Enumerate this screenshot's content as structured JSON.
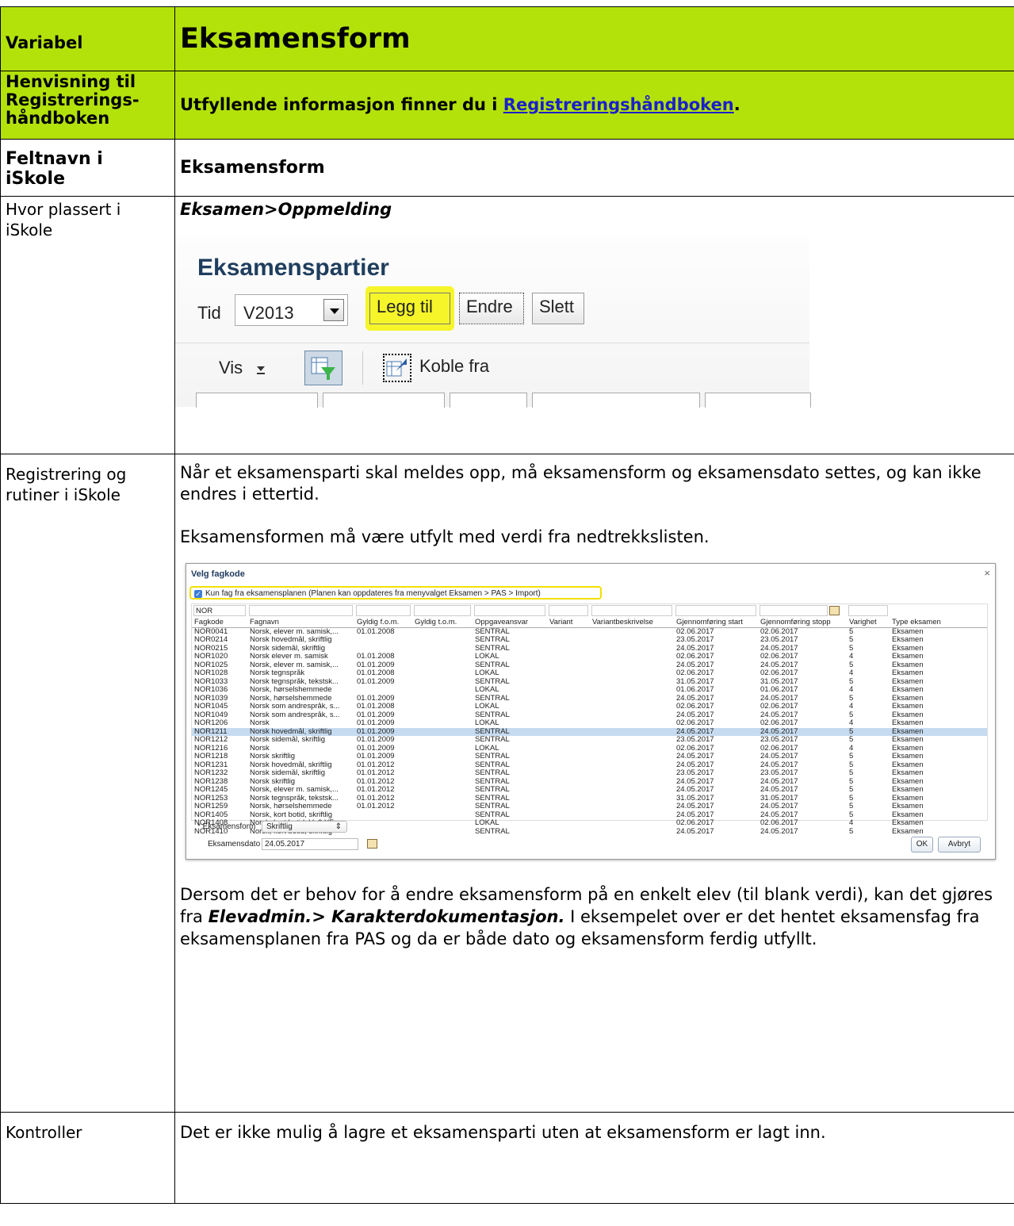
{
  "rows": {
    "variabel": {
      "label": "Variabel",
      "value": "Eksamensform"
    },
    "henvisning": {
      "label": "Henvisning til Registrerings-håndboken",
      "text_before": "Utfyllende informasjon finner du i ",
      "link": "Registreringshåndboken",
      "text_after": "."
    },
    "feltnavn": {
      "label": "Feltnavn i iSkole",
      "value": "Eksamensform"
    },
    "plassering": {
      "label": "Hvor plassert i iSkole",
      "path": "Eksamen>Oppmelding"
    },
    "registrering": {
      "label": "Registrering og rutiner i iSkole",
      "p1": "Når et eksamensparti skal meldes opp, må eksamensform og eksamensdato settes, og kan ikke endres i ettertid.",
      "p2": "Eksamensformen må være utfylt med verdi fra nedtrekkslisten.",
      "p3_before": "Dersom det er behov for å endre eksamensform på en enkelt elev (til blank verdi), kan det gjøres fra ",
      "p3_bold": "Elevadmin.> Karakterdokumentasjon.",
      "p3_after": " I eksempelet over er det hentet eksamensfag fra eksamensplanen fra PAS og da er både dato og eksamensform ferdig utfyllt."
    },
    "kontroller": {
      "label": "Kontroller",
      "text": "Det er ikke mulig å lagre et eksamensparti uten at eksamensform er lagt inn."
    }
  },
  "screenshot1": {
    "title": "Eksamenspartier",
    "tid_label": "Tid",
    "tid_value": "V2013",
    "buttons": {
      "add": "Legg til",
      "edit": "Endre",
      "delete": "Slett"
    },
    "vis": "Vis",
    "koble": "Koble fra",
    "highlight_color": "#f5f52a"
  },
  "screenshot2": {
    "title": "Velg fagkode",
    "close": "×",
    "checkbox_label": "Kun fag fra eksamensplanen   (Planen kan oppdateres fra menyvalget Eksamen > PAS > Import)",
    "filter_value": "NOR",
    "columns": [
      "Fagkode",
      "Fagnavn",
      "Gyldig f.o.m.",
      "Gyldig t.o.m.",
      "Oppgaveansvar",
      "Variant",
      "Variantbeskrivelse",
      "Gjennomføring start",
      "Gjennomføring stopp",
      "Varighet",
      "Type eksamen"
    ],
    "rows": [
      [
        "NOR0041",
        "Norsk, elever m. samisk,...",
        "01.01.2008",
        "",
        "SENTRAL",
        "",
        "",
        "02.06.2017",
        "02.06.2017",
        "5",
        "Eksamen"
      ],
      [
        "NOR0214",
        "Norsk hovedmål, skriftlig",
        "",
        "",
        "SENTRAL",
        "",
        "",
        "23.05.2017",
        "23.05.2017",
        "5",
        "Eksamen"
      ],
      [
        "NOR0215",
        "Norsk sidemål, skriftlig",
        "",
        "",
        "SENTRAL",
        "",
        "",
        "24.05.2017",
        "24.05.2017",
        "5",
        "Eksamen"
      ],
      [
        "NOR1020",
        "Norsk elever m. samisk",
        "01.01.2008",
        "",
        "LOKAL",
        "",
        "",
        "02.06.2017",
        "02.06.2017",
        "4",
        "Eksamen"
      ],
      [
        "NOR1025",
        "Norsk, elever m. samisk,...",
        "01.01.2009",
        "",
        "SENTRAL",
        "",
        "",
        "24.05.2017",
        "24.05.2017",
        "5",
        "Eksamen"
      ],
      [
        "NOR1028",
        "Norsk tegnspråk",
        "01.01.2008",
        "",
        "LOKAL",
        "",
        "",
        "02.06.2017",
        "02.06.2017",
        "4",
        "Eksamen"
      ],
      [
        "NOR1033",
        "Norsk tegnspråk, tekstsk...",
        "01.01.2009",
        "",
        "SENTRAL",
        "",
        "",
        "31.05.2017",
        "31.05.2017",
        "5",
        "Eksamen"
      ],
      [
        "NOR1036",
        "Norsk, hørselshemmede",
        "",
        "",
        "LOKAL",
        "",
        "",
        "01.06.2017",
        "01.06.2017",
        "4",
        "Eksamen"
      ],
      [
        "NOR1039",
        "Norsk, hørselshemmede",
        "01.01.2009",
        "",
        "SENTRAL",
        "",
        "",
        "24.05.2017",
        "24.05.2017",
        "5",
        "Eksamen"
      ],
      [
        "NOR1045",
        "Norsk som andrespråk, s...",
        "01.01.2008",
        "",
        "LOKAL",
        "",
        "",
        "02.06.2017",
        "02.06.2017",
        "4",
        "Eksamen"
      ],
      [
        "NOR1049",
        "Norsk som andrespråk, s...",
        "01.01.2009",
        "",
        "SENTRAL",
        "",
        "",
        "24.05.2017",
        "24.05.2017",
        "5",
        "Eksamen"
      ],
      [
        "NOR1206",
        "Norsk",
        "01.01.2009",
        "",
        "LOKAL",
        "",
        "",
        "02.06.2017",
        "02.06.2017",
        "4",
        "Eksamen"
      ],
      [
        "NOR1211",
        "Norsk hovedmål, skriftlig",
        "01.01.2009",
        "",
        "SENTRAL",
        "",
        "",
        "24.05.2017",
        "24.05.2017",
        "5",
        "Eksamen"
      ],
      [
        "NOR1212",
        "Norsk sidemål, skriftlig",
        "01.01.2009",
        "",
        "SENTRAL",
        "",
        "",
        "23.05.2017",
        "23.05.2017",
        "5",
        "Eksamen"
      ],
      [
        "NOR1216",
        "Norsk",
        "01.01.2009",
        "",
        "LOKAL",
        "",
        "",
        "02.06.2017",
        "02.06.2017",
        "4",
        "Eksamen"
      ],
      [
        "NOR1218",
        "Norsk skriftlig",
        "01.01.2009",
        "",
        "SENTRAL",
        "",
        "",
        "24.05.2017",
        "24.05.2017",
        "5",
        "Eksamen"
      ],
      [
        "NOR1231",
        "Norsk hovedmål, skriftlig",
        "01.01.2012",
        "",
        "SENTRAL",
        "",
        "",
        "24.05.2017",
        "24.05.2017",
        "5",
        "Eksamen"
      ],
      [
        "NOR1232",
        "Norsk sidemål, skriftlig",
        "01.01.2012",
        "",
        "SENTRAL",
        "",
        "",
        "23.05.2017",
        "23.05.2017",
        "5",
        "Eksamen"
      ],
      [
        "NOR1238",
        "Norsk skriftlig",
        "01.01.2012",
        "",
        "SENTRAL",
        "",
        "",
        "24.05.2017",
        "24.05.2017",
        "5",
        "Eksamen"
      ],
      [
        "NOR1245",
        "Norsk, elever m. samisk,...",
        "01.01.2012",
        "",
        "SENTRAL",
        "",
        "",
        "24.05.2017",
        "24.05.2017",
        "5",
        "Eksamen"
      ],
      [
        "NOR1253",
        "Norsk tegnspråk, tekstsk...",
        "01.01.2012",
        "",
        "SENTRAL",
        "",
        "",
        "31.05.2017",
        "31.05.2017",
        "5",
        "Eksamen"
      ],
      [
        "NOR1259",
        "Norsk, hørselshemmede",
        "01.01.2012",
        "",
        "SENTRAL",
        "",
        "",
        "24.05.2017",
        "24.05.2017",
        "5",
        "Eksamen"
      ],
      [
        "NOR1405",
        "Norsk, kort botid, skriftlig",
        "",
        "",
        "SENTRAL",
        "",
        "",
        "24.05.2017",
        "24.05.2017",
        "5",
        "Eksamen"
      ],
      [
        "NOR1408",
        "Norsk, kort botid, Vg2 YF",
        "",
        "",
        "LOKAL",
        "",
        "",
        "02.06.2017",
        "02.06.2017",
        "4",
        "Eksamen"
      ],
      [
        "NOR1410",
        "Norsk, kort botid, skriftlig",
        "",
        "",
        "SENTRAL",
        "",
        "",
        "24.05.2017",
        "24.05.2017",
        "5",
        "Eksamen"
      ]
    ],
    "selected_row": 12,
    "eksamensform_label": "* Eksamensform",
    "eksamensform_value": "Skriftlig",
    "eksamensdato_label": "Eksamensdato",
    "eksamensdato_value": "24.05.2017",
    "ok": "OK",
    "cancel": "Avbryt"
  },
  "colors": {
    "header_green": "#b3e20b",
    "link_blue": "#1b20c9",
    "selected_row": "#c6dbf0"
  }
}
